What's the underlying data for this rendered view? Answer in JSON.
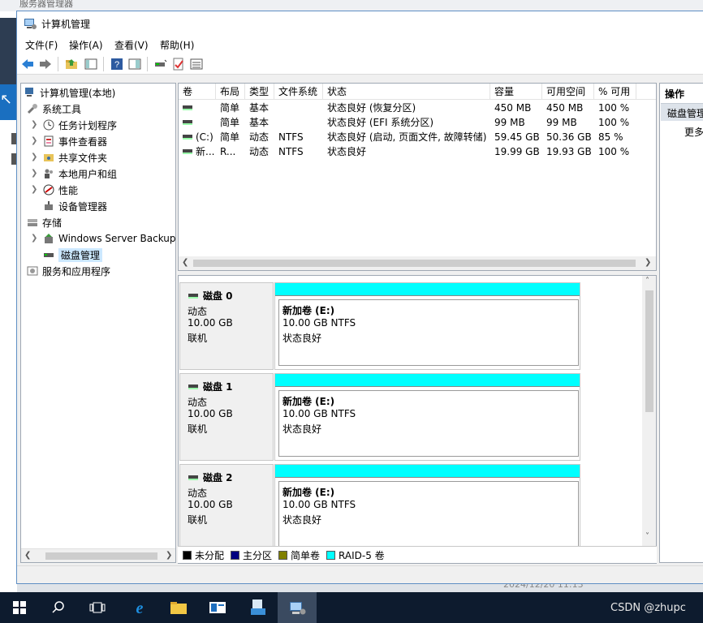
{
  "background": {
    "title": "服务器管理器",
    "clock": "2024/12/20 11:13"
  },
  "window": {
    "title": "计算机管理"
  },
  "menu": [
    "文件(F)",
    "操作(A)",
    "查看(V)",
    "帮助(H)"
  ],
  "toolbar_icons": [
    "back-arrow-icon",
    "forward-arrow-icon",
    "up-folder-icon",
    "show-hide-tree-icon",
    "help-icon",
    "properties-icon",
    "connect-disk-icon",
    "checklist-icon",
    "list-view-icon"
  ],
  "tree": {
    "root": "计算机管理(本地)",
    "system_tools": "系统工具",
    "task_scheduler": "任务计划程序",
    "event_viewer": "事件查看器",
    "shared_folders": "共享文件夹",
    "local_users": "本地用户和组",
    "performance": "性能",
    "device_manager": "设备管理器",
    "storage": "存储",
    "windows_backup": "Windows Server Backup",
    "disk_management": "磁盘管理",
    "services_apps": "服务和应用程序"
  },
  "volume_list": {
    "headers": [
      "卷",
      "布局",
      "类型",
      "文件系统",
      "状态",
      "容量",
      "可用空间",
      "% 可用"
    ],
    "rows": [
      [
        "",
        "简单",
        "基本",
        "",
        "状态良好 (恢复分区)",
        "450 MB",
        "450 MB",
        "100 %"
      ],
      [
        "",
        "简单",
        "基本",
        "",
        "状态良好 (EFI 系统分区)",
        "99 MB",
        "99 MB",
        "100 %"
      ],
      [
        "(C:)",
        "简单",
        "动态",
        "NTFS",
        "状态良好 (启动, 页面文件, 故障转储)",
        "59.45 GB",
        "50.36 GB",
        "85 %"
      ],
      [
        "新...",
        "R...",
        "动态",
        "NTFS",
        "状态良好",
        "19.99 GB",
        "19.93 GB",
        "100 %"
      ]
    ]
  },
  "disks": [
    {
      "name": "磁盘 0",
      "type": "动态",
      "size": "10.00 GB",
      "state": "联机",
      "vol_name": "新加卷  (E:)",
      "vol_size": "10.00 GB NTFS",
      "vol_status": "状态良好"
    },
    {
      "name": "磁盘 1",
      "type": "动态",
      "size": "10.00 GB",
      "state": "联机",
      "vol_name": "新加卷  (E:)",
      "vol_size": "10.00 GB NTFS",
      "vol_status": "状态良好"
    },
    {
      "name": "磁盘 2",
      "type": "动态",
      "size": "10.00 GB",
      "state": "联机",
      "vol_name": "新加卷  (E:)",
      "vol_size": "10.00 GB NTFS",
      "vol_status": "状态良好"
    }
  ],
  "legend": [
    {
      "label": "未分配",
      "color": "#000000"
    },
    {
      "label": "主分区",
      "color": "#000080"
    },
    {
      "label": "简单卷",
      "color": "#808000"
    },
    {
      "label": "RAID-5 卷",
      "color": "#00ffff"
    }
  ],
  "actions": {
    "header": "操作",
    "section": "磁盘管理",
    "more": "更多"
  },
  "taskbar": {
    "watermark": "CSDN @zhupc"
  },
  "colors": {
    "raid5": "#00ffff",
    "selection": "#cce8ff",
    "window_border": "#5f8fc4"
  }
}
